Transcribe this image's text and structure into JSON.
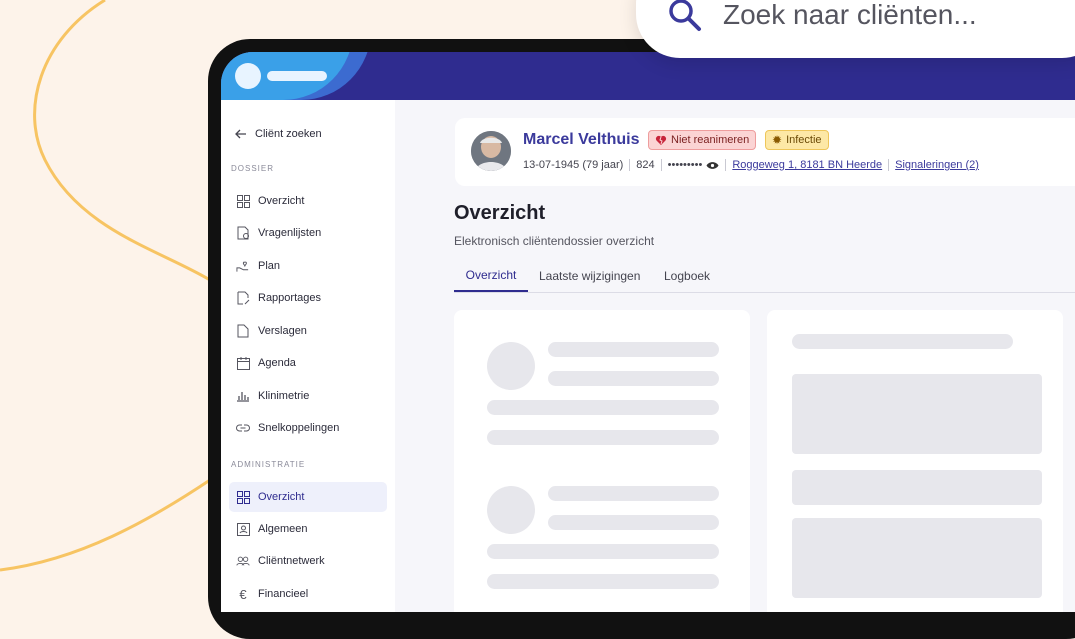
{
  "search": {
    "placeholder": "Zoek naar cliënten...",
    "icon": "search-icon"
  },
  "sidebar": {
    "back_label": "Cliënt zoeken",
    "section_dossier": "DOSSIER",
    "dossier_items": [
      {
        "label": "Overzicht",
        "icon": "grid-icon"
      },
      {
        "label": "Vragenlijsten",
        "icon": "questionnaire-icon"
      },
      {
        "label": "Plan",
        "icon": "hand-heart-icon"
      },
      {
        "label": "Rapportages",
        "icon": "edit-document-icon"
      },
      {
        "label": "Verslagen",
        "icon": "document-icon"
      },
      {
        "label": "Agenda",
        "icon": "calendar-icon"
      },
      {
        "label": "Klinimetrie",
        "icon": "bar-chart-icon"
      },
      {
        "label": "Snelkoppelingen",
        "icon": "link-icon"
      }
    ],
    "section_admin": "ADMINISTRATIE",
    "admin_items": [
      {
        "label": "Overzicht",
        "icon": "grid-icon",
        "active": true
      },
      {
        "label": "Algemeen",
        "icon": "id-card-icon"
      },
      {
        "label": "Cliëntnetwerk",
        "icon": "people-icon"
      },
      {
        "label": "Financieel",
        "icon": "euro-icon"
      }
    ]
  },
  "patient": {
    "name": "Marcel Velthuis",
    "badge_resus": "Niet reanimeren",
    "badge_infection": "Infectie",
    "dob": "13-07-1945 (79 jaar)",
    "number": "824",
    "masked_id": "•••••••••",
    "address": "Roggeweg 1, 8181 BN Heerde",
    "signals": "Signaleringen (2)"
  },
  "page": {
    "title": "Overzicht",
    "subtitle": "Elektronisch cliëntendossier overzicht",
    "tabs": [
      {
        "label": "Overzicht",
        "active": true
      },
      {
        "label": "Laatste wijzigingen"
      },
      {
        "label": "Logboek"
      }
    ]
  },
  "colors": {
    "brand": "#2f2c8f",
    "accent": "#3aa0e8",
    "danger_badge": "#fbd4d4",
    "warning_badge": "#fde8a6",
    "background": "#fdf3ea"
  }
}
